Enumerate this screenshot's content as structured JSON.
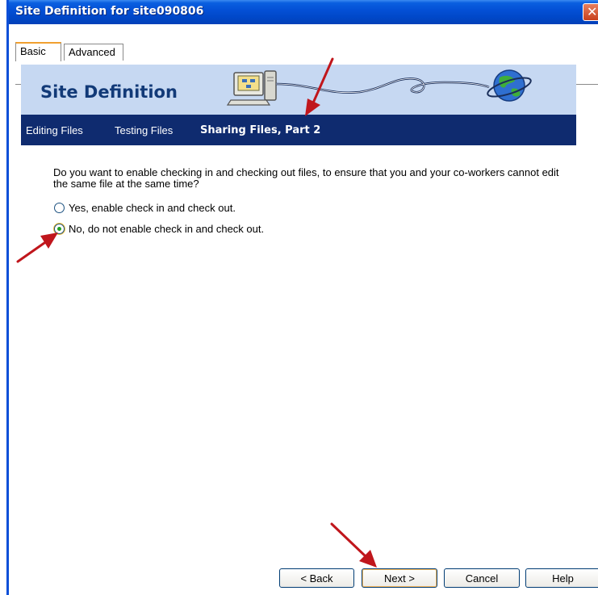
{
  "window": {
    "title": "Site Definition for site090806",
    "close_symbol": "✕"
  },
  "tabs": [
    {
      "label": "Basic",
      "active": true
    },
    {
      "label": "Advanced",
      "active": false
    }
  ],
  "banner": {
    "title": "Site Definition"
  },
  "steps": [
    {
      "label": "Editing Files"
    },
    {
      "label": "Testing Files"
    },
    {
      "label": "Sharing Files, Part 2"
    }
  ],
  "question": "Do you want to enable checking in and checking out files, to ensure that you and your co-workers cannot edit the same file at the same time?",
  "options": [
    {
      "label": "Yes, enable check in and check out.",
      "selected": false
    },
    {
      "label": "No, do not enable check in and check out.",
      "selected": true
    }
  ],
  "buttons": {
    "back": "< Back",
    "next": "Next >",
    "cancel": "Cancel",
    "help": "Help"
  },
  "colors": {
    "titlebar": "#0451d6",
    "banner": "#c6d8f2",
    "navbar": "#0f2b6f",
    "annotation_arrow": "#c0161c"
  }
}
